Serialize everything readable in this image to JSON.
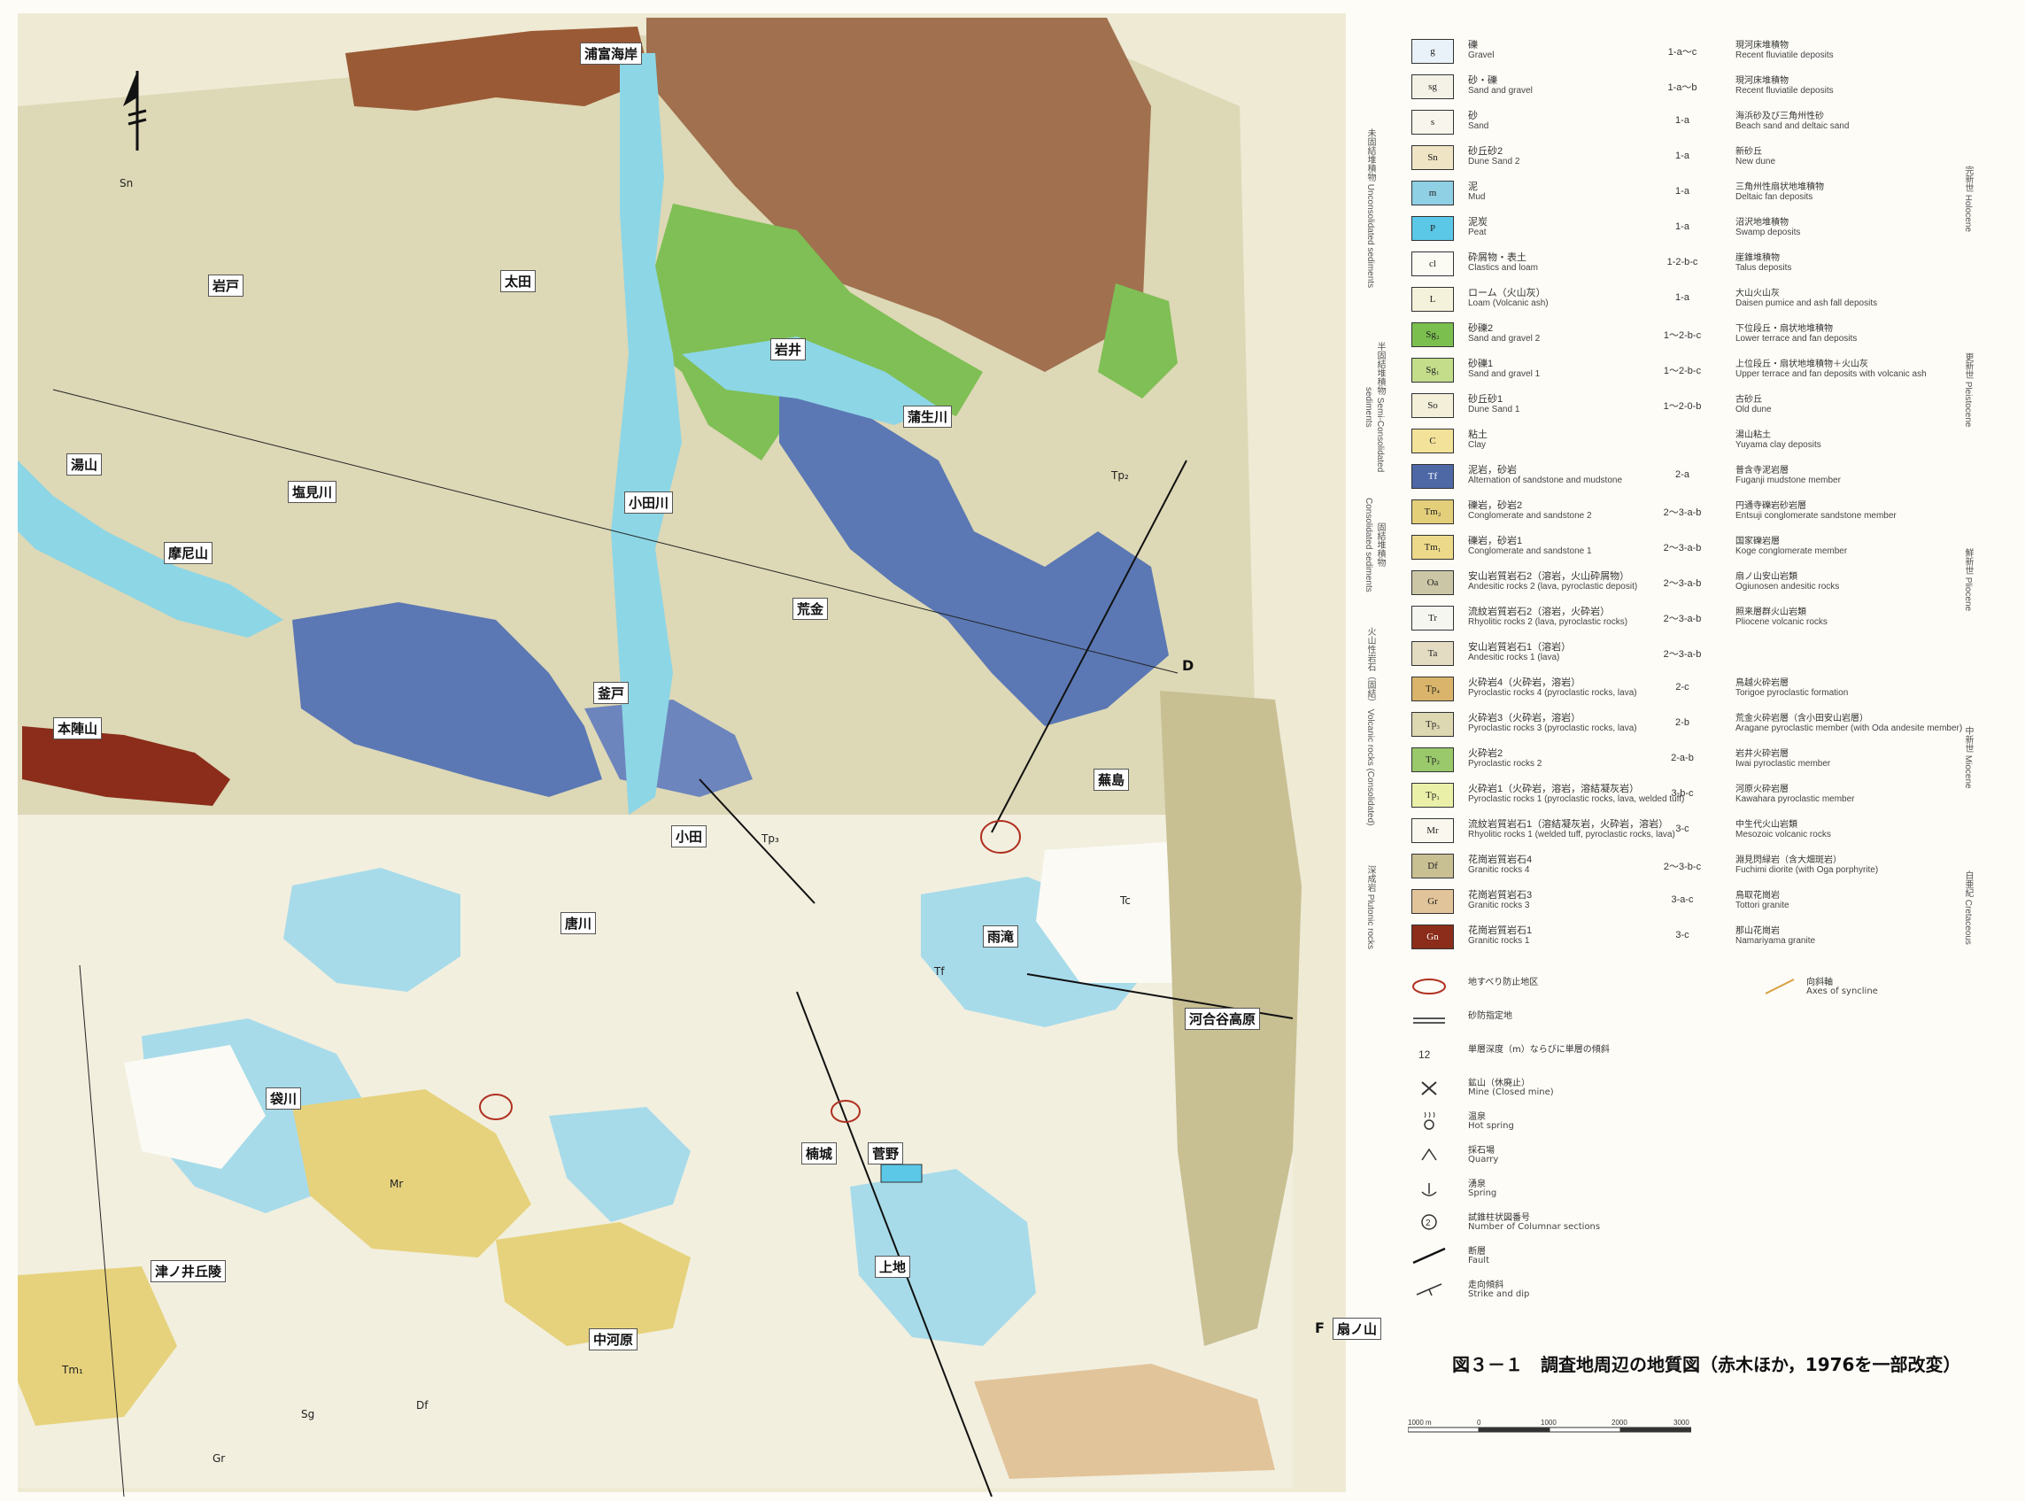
{
  "north_arrow": {
    "icon": "north-arrow-icon"
  },
  "places": [
    {
      "label": "浦富海岸"
    },
    {
      "label": "岩戸"
    },
    {
      "label": "太田"
    },
    {
      "label": "岩井"
    },
    {
      "label": "蒲生川"
    },
    {
      "label": "湯山"
    },
    {
      "label": "塩見川"
    },
    {
      "label": "小田川"
    },
    {
      "label": "摩尼山"
    },
    {
      "label": "荒金"
    },
    {
      "label": "釜戸"
    },
    {
      "label": "本陣山"
    },
    {
      "label": "蕪島"
    },
    {
      "label": "小田"
    },
    {
      "label": "唐川"
    },
    {
      "label": "雨滝"
    },
    {
      "label": "河合谷高原"
    },
    {
      "label": "袋川"
    },
    {
      "label": "楠城"
    },
    {
      "label": "菅野"
    },
    {
      "label": "上地"
    },
    {
      "label": "津ノ井丘陵"
    },
    {
      "label": "中河原"
    },
    {
      "label": "扇ノ山"
    }
  ],
  "map_codes": [
    {
      "code": "Tp₂"
    },
    {
      "code": "Tp₃"
    },
    {
      "code": "Tf"
    },
    {
      "code": "Mr"
    },
    {
      "code": "Df"
    },
    {
      "code": "Sn"
    },
    {
      "code": "Sg"
    },
    {
      "code": "Tm₁"
    },
    {
      "code": "Gr"
    },
    {
      "code": "Tc"
    }
  ],
  "section_markers": [
    {
      "label": "D"
    },
    {
      "label": "F"
    }
  ],
  "legend": {
    "units": [
      {
        "sym": "g",
        "jp": "礫",
        "en": "Gravel",
        "code": "1-a～c",
        "fjp": "現河床堆積物",
        "fen": "Recent fluviatile deposits",
        "color": "#e9f2f8"
      },
      {
        "sym": "sg",
        "jp": "砂・礫",
        "en": "Sand and gravel",
        "code": "1-a～b",
        "fjp": "現河床堆積物",
        "fen": "Recent fluviatile deposits",
        "color": "#f4f1e6"
      },
      {
        "sym": "s",
        "jp": "砂",
        "en": "Sand",
        "code": "1-a",
        "fjp": "海浜砂及び三角州性砂",
        "fen": "Beach sand and deltaic sand",
        "color": "#f7f5ec"
      },
      {
        "sym": "Sn",
        "jp": "砂丘砂2",
        "en": "Dune Sand 2",
        "code": "1-a",
        "fjp": "新砂丘",
        "fen": "New dune",
        "color": "#efe5c5"
      },
      {
        "sym": "m",
        "jp": "泥",
        "en": "Mud",
        "code": "1-a",
        "fjp": "三角州性扇状地堆積物",
        "fen": "Deltaic fan deposits",
        "color": "#8fd0e5"
      },
      {
        "sym": "P",
        "jp": "泥炭",
        "en": "Peat",
        "code": "1-a",
        "fjp": "沼沢地堆積物",
        "fen": "Swamp deposits",
        "color": "#5cc8e8"
      },
      {
        "sym": "cl",
        "jp": "砕屑物・表土",
        "en": "Clastics and loam",
        "code": "1-2-b-c",
        "fjp": "崖錐堆積物",
        "fen": "Talus deposits",
        "color": "#fbfaf3"
      },
      {
        "sym": "L",
        "jp": "ローム（火山灰）",
        "en": "Loam (Volcanic ash)",
        "code": "1-a",
        "fjp": "大山火山灰",
        "fen": "Daisen pumice and ash fall deposits",
        "color": "#f5f2dc"
      },
      {
        "sym": "Sg₂",
        "jp": "砂礫2",
        "en": "Sand and gravel 2",
        "code": "1～2-b-c",
        "fjp": "下位段丘・扇状地堆積物",
        "fen": "Lower terrace and fan deposits",
        "color": "#7bbf4f"
      },
      {
        "sym": "Sg₁",
        "jp": "砂礫1",
        "en": "Sand and gravel 1",
        "code": "1～2-b-c",
        "fjp": "上位段丘・扇状地堆積物＋火山灰",
        "fen": "Upper terrace and fan deposits with volcanic ash",
        "color": "#c3dd8a"
      },
      {
        "sym": "So",
        "jp": "砂丘砂1",
        "en": "Dune Sand 1",
        "code": "1～2-0-b",
        "fjp": "古砂丘",
        "fen": "Old dune",
        "color": "#f4efd9"
      },
      {
        "sym": "C",
        "jp": "粘土",
        "en": "Clay",
        "code": "",
        "fjp": "湯山粘土",
        "fen": "Yuyama clay deposits",
        "color": "#f2e29a"
      },
      {
        "sym": "Tf",
        "jp": "泥岩，砂岩",
        "en": "Alternation of sandstone and mudstone",
        "code": "2-a",
        "fjp": "普含寺泥岩層",
        "fen": "Fuganji mudstone member",
        "color": "#4e68a6"
      },
      {
        "sym": "Tm₂",
        "jp": "礫岩，砂岩2",
        "en": "Conglomerate and sandstone 2",
        "code": "2～3-a-b",
        "fjp": "円通寺礫岩砂岩層",
        "fen": "Entsuji conglomerate sandstone member",
        "color": "#e3cf7a"
      },
      {
        "sym": "Tm₁",
        "jp": "礫岩，砂岩1",
        "en": "Conglomerate and sandstone 1",
        "code": "2～3-a-b",
        "fjp": "国家礫岩層",
        "fen": "Koge conglomerate member",
        "color": "#ecd98a"
      },
      {
        "sym": "Oa",
        "jp": "安山岩質岩石2（溶岩，火山砕屑物）",
        "en": "Andesitic rocks 2 (lava, pyroclastic deposit)",
        "code": "2～3-a-b",
        "fjp": "扇ノ山安山岩類",
        "fen": "Ogiunosen andesitic rocks",
        "color": "#cbc6a6"
      },
      {
        "sym": "Tr",
        "jp": "流紋岩質岩石2（溶岩，火砕岩）",
        "en": "Rhyolitic rocks 2 (lava, pyroclastic rocks)",
        "code": "2～3-a-b",
        "fjp": "照来層群火山岩類",
        "fen": "Pliocene volcanic rocks",
        "color": "#f6f6f1"
      },
      {
        "sym": "Ta",
        "jp": "安山岩質岩石1（溶岩）",
        "en": "Andesitic rocks 1 (lava)",
        "code": "2～3-a-b",
        "fjp": "",
        "fen": "",
        "color": "#e4dcc2"
      },
      {
        "sym": "Tp₄",
        "jp": "火砕岩4（火砕岩，溶岩）",
        "en": "Pyroclastic rocks 4 (pyroclastic rocks, lava)",
        "code": "2-c",
        "fjp": "鳥越火砕岩層",
        "fen": "Torigoe pyroclastic formation",
        "color": "#d9b46a"
      },
      {
        "sym": "Tp₃",
        "jp": "火砕岩3（火砕岩，溶岩）",
        "en": "Pyroclastic rocks 3 (pyroclastic rocks, lava)",
        "code": "2-b",
        "fjp": "荒金火砕岩層（含小田安山岩層）",
        "fen": "Aragane pyroclastic member (with Oda andesite member)",
        "color": "#ddd7b2"
      },
      {
        "sym": "Tp₂",
        "jp": "火砕岩2",
        "en": "Pyroclastic rocks 2",
        "code": "2-a-b",
        "fjp": "岩井火砕岩層",
        "fen": "Iwai pyroclastic member",
        "color": "#9ac96c"
      },
      {
        "sym": "Tp₁",
        "jp": "火砕岩1（火砕岩，溶岩，溶結凝灰岩）",
        "en": "Pyroclastic rocks 1 (pyroclastic rocks, lava, welded tuff)",
        "code": "3-b-c",
        "fjp": "河原火砕岩層",
        "fen": "Kawahara pyroclastic member",
        "color": "#eaf0a8"
      },
      {
        "sym": "Mr",
        "jp": "流紋岩質岩石1（溶結凝灰岩，火砕岩，溶岩）",
        "en": "Rhyolitic rocks 1 (welded tuff, pyroclastic rocks, lava)",
        "code": "3-c",
        "fjp": "中生代火山岩類",
        "fen": "Mesozoic volcanic rocks",
        "color": "#faf8ee"
      },
      {
        "sym": "Df",
        "jp": "花崗岩質岩石4",
        "en": "Granitic rocks 4",
        "code": "2～3-b-c",
        "fjp": "淵見閃緑岩（含大畑斑岩）",
        "fen": "Fuchimi diorite (with Oga porphyrite)",
        "color": "#c8bf93"
      },
      {
        "sym": "Gr",
        "jp": "花崗岩質岩石3",
        "en": "Granitic rocks 3",
        "code": "3-a-c",
        "fjp": "鳥取花崗岩",
        "fen": "Tottori granite",
        "color": "#e2c49a"
      },
      {
        "sym": "Gn",
        "jp": "花崗岩質岩石1",
        "en": "Granitic rocks 1",
        "code": "3-c",
        "fjp": "那山花崗岩",
        "fen": "Namariyama granite",
        "color": "#8b2d1a"
      }
    ],
    "groups": [
      {
        "label": "未固結堆積物 Unconsolidated sediments"
      },
      {
        "label": "半固結堆積物 Semi-Consolidated sediments"
      },
      {
        "label": "固結堆積物 Consolidated sediments"
      },
      {
        "label": "火山性岩石（固結） Volcanic rocks (Consolidated)"
      },
      {
        "label": "深成岩 Plutonic rocks"
      }
    ],
    "ages": [
      {
        "label": "完新世 Holocene"
      },
      {
        "label": "更新世 Pleistocene"
      },
      {
        "label": "鮮新世 Pliocene"
      },
      {
        "label": "中新世 Miocene"
      },
      {
        "label": "白亜紀 Cretaceous"
      }
    ],
    "symbols": [
      {
        "jp": "地すべり防止地区",
        "en": ""
      },
      {
        "jp": "砂防指定地",
        "en": ""
      },
      {
        "jp": "単層深度（m）ならびに単層の傾斜",
        "en": ""
      },
      {
        "jp": "鉱山（休廃止）",
        "en": "Mine (Closed mine)"
      },
      {
        "jp": "温泉",
        "en": "Hot spring"
      },
      {
        "jp": "採石場",
        "en": "Quarry"
      },
      {
        "jp": "湧泉",
        "en": "Spring"
      },
      {
        "jp": "試錐柱状図番号",
        "en": "Number of Columnar sections"
      },
      {
        "jp": "断層",
        "en": "Fault"
      },
      {
        "jp": "走向傾斜",
        "en": "Strike and dip"
      }
    ],
    "syncline": {
      "jp": "向斜軸",
      "en": "Axes of syncline"
    }
  },
  "caption": "図３－１　調査地周辺の地質図（赤木ほか，1976を一部改変）",
  "scale": {
    "labels": [
      "1000 m",
      "0",
      "1000",
      "2000",
      "3000"
    ]
  },
  "colors": {
    "tertiary_blue": "#5b78b4",
    "river_cyan": "#8dd6e6",
    "pyroclastic_beige": "#ddd8b6",
    "mudstone_gold": "#e6d27c",
    "granite_brown": "#a0704f",
    "green_terrace": "#7fbf55",
    "pale": "#f5f3e6"
  }
}
